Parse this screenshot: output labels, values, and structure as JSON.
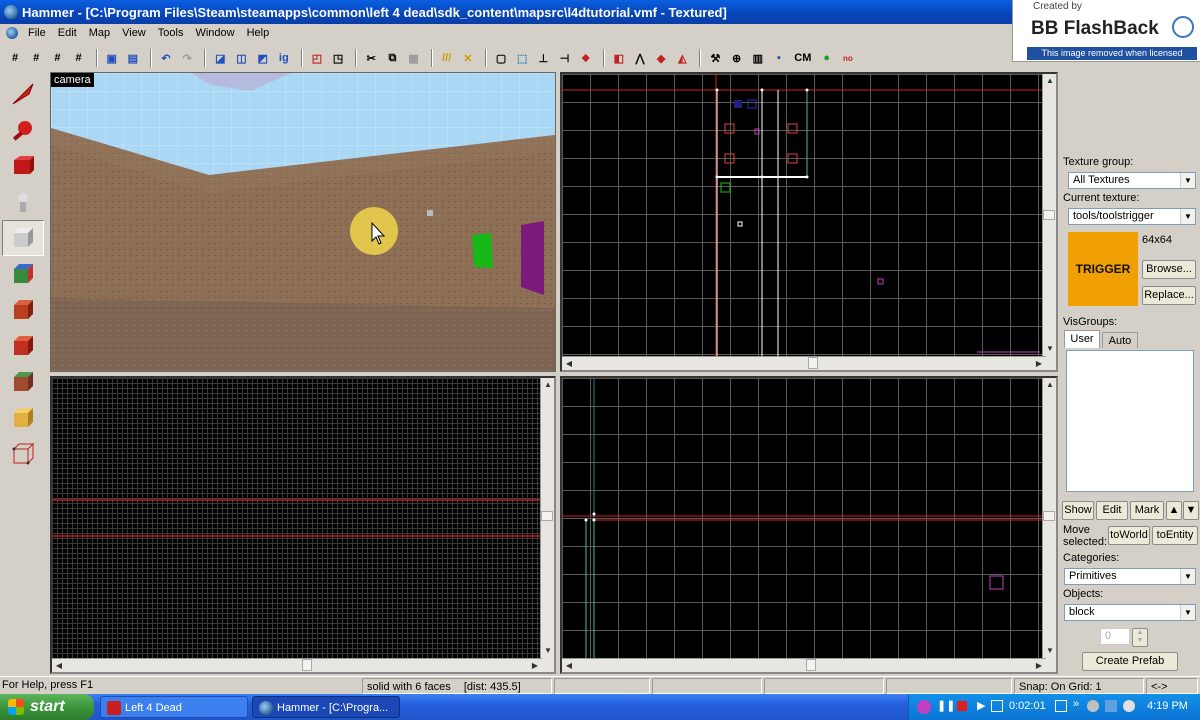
{
  "window": {
    "title": "Hammer - [C:\\Program Files\\Steam\\steamapps\\common\\left 4 dead\\sdk_content\\mapsrc\\l4dtutorial.vmf - Textured]"
  },
  "watermark": {
    "created_by": "Created by",
    "product": "BB FlashBack",
    "note": "This image removed when licensed"
  },
  "menu": [
    "File",
    "Edit",
    "Map",
    "View",
    "Tools",
    "Window",
    "Help"
  ],
  "toolbar": {
    "cm_label": "CM"
  },
  "palette": [
    "selection-tool",
    "magnify-tool",
    "camera-tool",
    "entity-tool",
    "block-tool",
    "texture-application-tool",
    "apply-current-texture-tool",
    "decal-tool",
    "overlay-tool",
    "clipping-tool",
    "vertex-tool"
  ],
  "camera": {
    "label": "camera"
  },
  "right_panel": {
    "texture_group_label": "Texture group:",
    "texture_group_value": "All Textures",
    "current_texture_label": "Current texture:",
    "current_texture_value": "tools/toolstrigger",
    "texture_swatch_text": "TRIGGER",
    "texture_size": "64x64",
    "browse_label": "Browse...",
    "replace_label": "Replace...",
    "visgroups_label": "VisGroups:",
    "tab_user": "User",
    "tab_auto": "Auto",
    "show_label": "Show",
    "edit_label": "Edit",
    "mark_label": "Mark",
    "move_selected_label": "Move selected:",
    "to_world_label": "toWorld",
    "to_entity_label": "toEntity",
    "categories_label": "Categories:",
    "categories_value": "Primitives",
    "objects_label": "Objects:",
    "objects_value": "block",
    "faces_value": "0",
    "create_prefab_label": "Create Prefab"
  },
  "status": {
    "help": "For Help, press F1",
    "selection": "solid with 6 faces",
    "dist": "[dist: 435.5]",
    "snap": "Snap: On Grid: 1",
    "arrows": "<->"
  },
  "taskbar": {
    "start": "start",
    "tasks": [
      {
        "label": "Left 4 Dead"
      },
      {
        "label": "Hammer - [C:\\Progra..."
      }
    ],
    "recorder_time": "0:02:01",
    "clock": "4:19 PM"
  }
}
